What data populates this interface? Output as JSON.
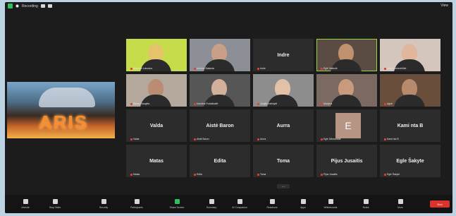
{
  "topbar": {
    "recording_label": "Recording",
    "view_label": "View"
  },
  "screen_share": {
    "text": "ARIS"
  },
  "participants": [
    {
      "name": "Ramune Lukosius",
      "display": "video",
      "face": "#e5c36a",
      "bg": "#c7dc4a"
    },
    {
      "name": "Andrius Balanda",
      "display": "video",
      "face": "#c9a087",
      "bg": "#8c8f95"
    },
    {
      "name": "Indre",
      "display": "name"
    },
    {
      "name": "Eglė Vaitkutė",
      "display": "video",
      "face": "#c0916f",
      "bg": "#5a4c43",
      "active": true
    },
    {
      "name": "Daiva Linkevičiūtė",
      "display": "video",
      "face": "#e1b79c",
      "bg": "#d5c6bd"
    },
    {
      "name": "Rimas Daugėla",
      "display": "video",
      "face": "#ba8d72",
      "bg": "#b4a79c"
    },
    {
      "name": "Karolina Rubaškaitė",
      "display": "video",
      "face": "#d3b09a",
      "bg": "#565656"
    },
    {
      "name": "Jurgita Kalėdytė",
      "display": "video",
      "face": "#e2c1a9",
      "bg": "#8d8d8d"
    },
    {
      "name": "Martyna",
      "display": "video",
      "face": "#c89a7e",
      "bg": "#7a6a62"
    },
    {
      "name": "Agnė",
      "display": "video",
      "face": "#b88a6d",
      "bg": "#6a4e3c"
    },
    {
      "name": "Valda",
      "display": "name"
    },
    {
      "name": "Aistė Baron",
      "display": "name"
    },
    {
      "name": "Aurra",
      "display": "name"
    },
    {
      "name": "Egle Dikmonaite",
      "display": "avatar",
      "initial": "E"
    },
    {
      "name": "Kami nta B",
      "display": "name"
    },
    {
      "name": "Matas",
      "display": "name"
    },
    {
      "name": "Edita",
      "display": "name"
    },
    {
      "name": "Toma",
      "display": "name"
    },
    {
      "name": "Pijus Jusaitis",
      "display": "name"
    },
    {
      "name": "Egle Šakyte",
      "display": "name"
    }
  ],
  "pager": {
    "label": "..."
  },
  "toolbar": {
    "items": [
      {
        "label": "Unmute",
        "icon": "microphone-icon"
      },
      {
        "label": "Stop Video",
        "icon": "video-camera-icon"
      },
      {
        "label": "Security",
        "icon": "shield-icon"
      },
      {
        "label": "Participants",
        "icon": "participants-icon"
      },
      {
        "label": "Share Screen",
        "icon": "share-screen-icon"
      },
      {
        "label": "Summary",
        "icon": "summary-icon"
      },
      {
        "label": "AI Companion",
        "icon": "ai-companion-icon"
      },
      {
        "label": "Reactions",
        "icon": "reactions-icon"
      },
      {
        "label": "Apps",
        "icon": "apps-icon"
      },
      {
        "label": "Whiteboards",
        "icon": "whiteboard-icon"
      },
      {
        "label": "Notes",
        "icon": "notes-icon"
      },
      {
        "label": "More",
        "icon": "more-icon"
      }
    ],
    "end_label": "End"
  },
  "colors": {
    "accent_green": "#2ec05a",
    "end_red": "#d9342b",
    "active_speaker": "#9bd33f"
  }
}
